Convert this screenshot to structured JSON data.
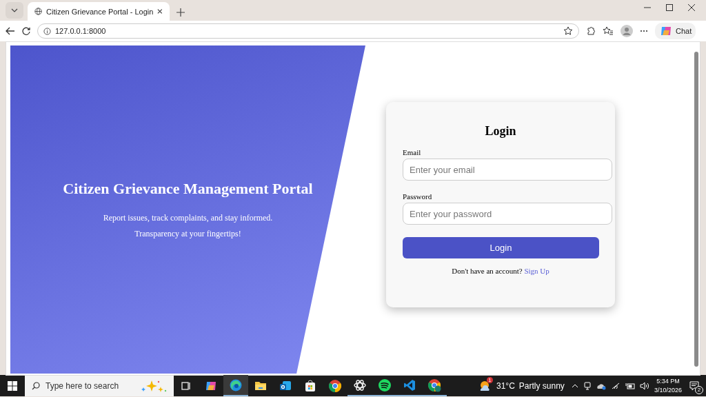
{
  "browser": {
    "tab_title": "Citizen Grievance Portal - Login",
    "url": "127.0.0.1:8000",
    "chat_label": "Chat"
  },
  "hero": {
    "title": "Citizen Grievance Management Portal",
    "subtitle_lines": [
      "Report issues, track complaints, and stay informed.",
      "Transparency at your fingertips!"
    ]
  },
  "login": {
    "heading": "Login",
    "fields": [
      {
        "label": "Email",
        "placeholder": "Enter your email"
      },
      {
        "label": "Password",
        "placeholder": "Enter your password"
      }
    ],
    "button": "Login",
    "signup_prompt": "Don't have an account?",
    "signup_link": "Sign Up"
  },
  "taskbar": {
    "search_placeholder": "Type here to search",
    "apps": [
      {
        "kind": "taskview",
        "running": false,
        "selected": false
      },
      {
        "kind": "copilot",
        "running": false,
        "selected": false
      },
      {
        "kind": "edge",
        "running": true,
        "selected": true
      },
      {
        "kind": "folder",
        "running": false,
        "selected": false
      },
      {
        "kind": "mail",
        "running": false,
        "selected": false
      },
      {
        "kind": "store",
        "running": false,
        "selected": false
      },
      {
        "kind": "chrome",
        "running": false,
        "selected": false
      },
      {
        "kind": "knot",
        "running": true,
        "selected": false
      },
      {
        "kind": "spotify",
        "running": true,
        "selected": false
      },
      {
        "kind": "vscode",
        "running": true,
        "selected": false
      },
      {
        "kind": "chromeprofile",
        "running": true,
        "selected": false
      }
    ],
    "weather_badge": "1",
    "temperature": "31°C",
    "weather": "Partly sunny",
    "time": "5:34 PM",
    "date": "3/10/2026",
    "notification_count": "2"
  }
}
